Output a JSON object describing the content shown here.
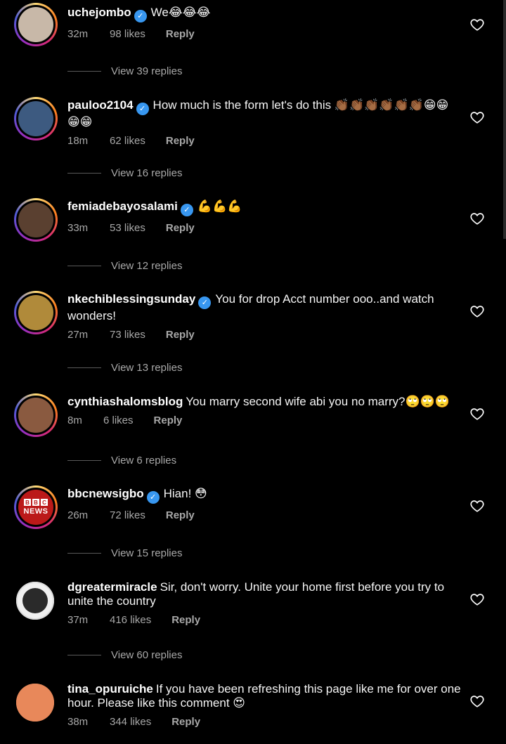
{
  "comments": [
    {
      "username": "uchejombo",
      "verified": true,
      "text": "We😂😂😂",
      "time": "32m",
      "likes": "98 likes",
      "reply": "Reply",
      "view_replies": "View 39 replies",
      "avatar_color": "#c8b8a8"
    },
    {
      "username": "pauloo2104",
      "verified": true,
      "text": "How much is the form let's do this 👏🏾👏🏾👏🏾👏🏾👏🏾👏🏾😁😁😁😁",
      "time": "18m",
      "likes": "62 likes",
      "reply": "Reply",
      "view_replies": "View 16 replies",
      "avatar_color": "#3d5a80"
    },
    {
      "username": "femiadebayosalami",
      "verified": true,
      "text": "💪💪💪",
      "time": "33m",
      "likes": "53 likes",
      "reply": "Reply",
      "view_replies": "View 12 replies",
      "avatar_color": "#5a4030"
    },
    {
      "username": "nkechiblessingsunday",
      "verified": true,
      "text": "You for drop Acct number ooo..and watch wonders!",
      "time": "27m",
      "likes": "73 likes",
      "reply": "Reply",
      "view_replies": "View 13 replies",
      "avatar_color": "#b08a3a"
    },
    {
      "username": "cynthiashalomsblog",
      "verified": false,
      "text": "You marry second wife abi you no marry?🙄🙄🙄",
      "time": "8m",
      "likes": "6 likes",
      "reply": "Reply",
      "view_replies": "View 6 replies",
      "avatar_color": "#8a5a40"
    },
    {
      "username": "bbcnewsigbo",
      "verified": true,
      "text": "Hian! 😳",
      "time": "26m",
      "likes": "72 likes",
      "reply": "Reply",
      "view_replies": "View 15 replies",
      "avatar_color": "#bb1919"
    },
    {
      "username": "dgreatermiracle",
      "verified": false,
      "text": "Sir, don't worry. Unite your home first before you try to unite the country",
      "time": "37m",
      "likes": "416 likes",
      "reply": "Reply",
      "view_replies": "View 60 replies",
      "avatar_color": "#2a2a2a"
    },
    {
      "username": "tina_opuruiche",
      "verified": false,
      "text": "If you have been refreshing this page like me for over one hour. Please like this comment 😍",
      "time": "38m",
      "likes": "344 likes",
      "reply": "Reply",
      "avatar_color": "#e8885a"
    }
  ],
  "bbc_logo": {
    "letters": [
      "B",
      "B",
      "C"
    ],
    "word": "NEWS"
  },
  "icons": {
    "heart": "heart-outline-icon",
    "verified": "verified-badge-icon"
  }
}
